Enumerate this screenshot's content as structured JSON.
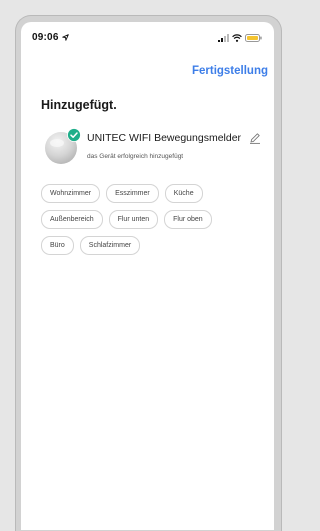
{
  "status_bar": {
    "time": "09:06"
  },
  "header": {
    "done_label": "Fertigstellung"
  },
  "main": {
    "title": "Hinzugefügt.",
    "device": {
      "name": "UNITEC WIFI Bewegungsmelder",
      "status": "das Gerät erfolgreich hinzugefügt"
    },
    "rooms": [
      [
        "Wohnzimmer",
        "Esszimmer",
        "Küche"
      ],
      [
        "Außenbereich",
        "Flur unten",
        "Flur oben"
      ],
      [
        "Büro",
        "Schlafzimmer"
      ]
    ]
  },
  "colors": {
    "accent": "#3d7ee8",
    "success": "#1fae8a",
    "battery": "#f4c430"
  }
}
